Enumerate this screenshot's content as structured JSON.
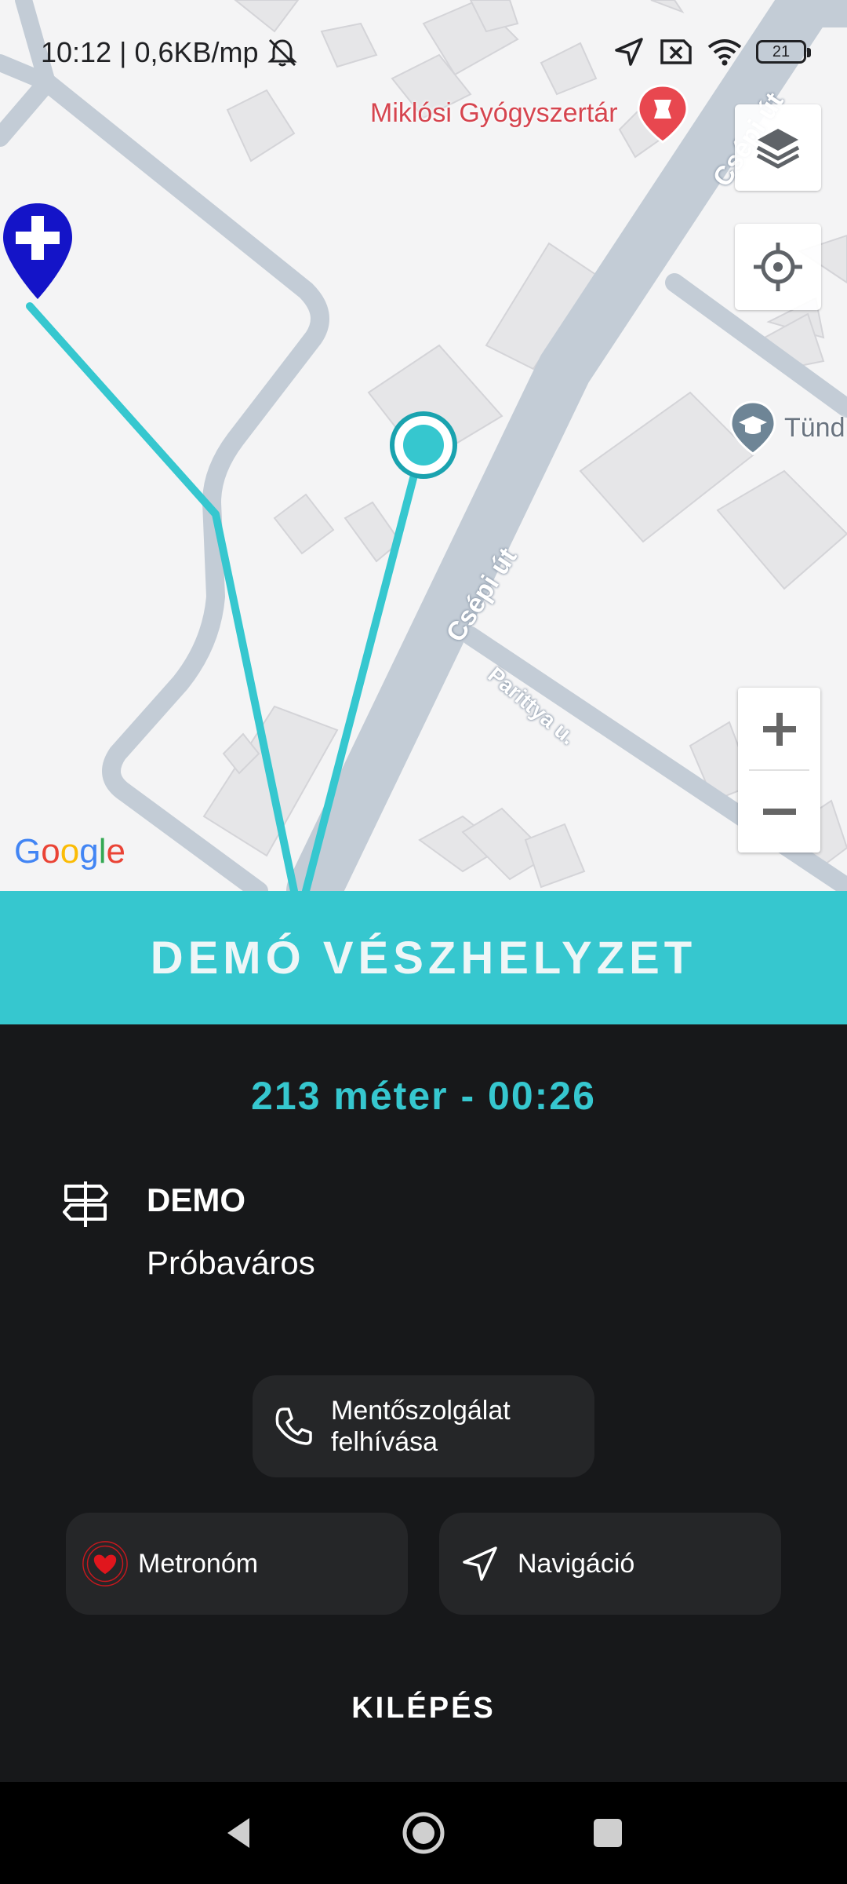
{
  "status_bar": {
    "time_speed": "10:12 | 0,6KB/mp",
    "battery": "21",
    "icons": [
      "bell-off-icon",
      "location-arrow-icon",
      "sim-x-icon",
      "wifi-icon",
      "battery-icon"
    ]
  },
  "map": {
    "poi_pharmacy": "Miklósi Gyógyszertár",
    "poi_school": "Tünd",
    "street_1": "Csépi út",
    "street_2": "Csépi út",
    "street_3": "Parittya u.",
    "google_logo": "Google",
    "controls": {
      "layers": "layers-icon",
      "my_location": "crosshair-icon",
      "zoom_in": "+",
      "zoom_out": "−"
    },
    "colors": {
      "route": "#36c7cf",
      "road": "#c3ccd6",
      "destination_pin": "#1414c8"
    }
  },
  "banner": {
    "title": "DEMÓ VÉSZHELYZET",
    "color": "#36c7cf"
  },
  "info": {
    "distance_eta": "213 méter - 00:26",
    "address_name": "DEMO",
    "address_city": "Próbaváros"
  },
  "actions": {
    "call_ambulance": "Mentőszolgálat felhívása",
    "metronome": "Metronóm",
    "navigation": "Navigáció",
    "exit": "KILÉPÉS"
  },
  "nav_bar": {
    "back": "back-icon",
    "home": "home-icon",
    "recents": "recents-icon"
  }
}
